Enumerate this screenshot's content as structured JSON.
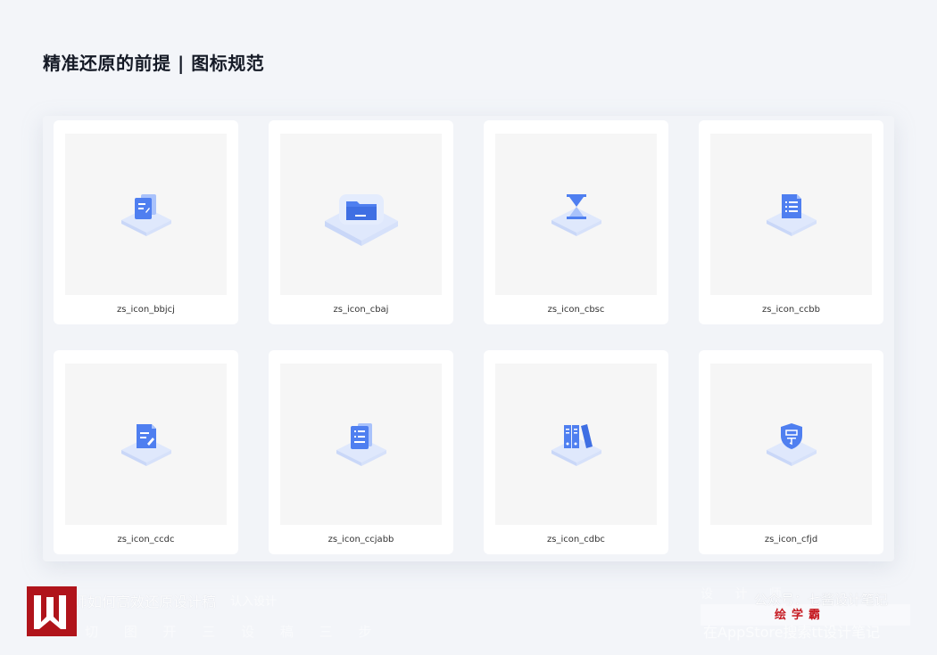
{
  "header": {
    "title": "精准还原的前提 | 图标规范"
  },
  "icons": [
    {
      "name": "zs_icon_bbjcj"
    },
    {
      "name": "zs_icon_cbaj"
    },
    {
      "name": "zs_icon_cbsc"
    },
    {
      "name": "zs_icon_ccbb"
    },
    {
      "name": "zs_icon_ccdc"
    },
    {
      "name": "zs_icon_ccjabb"
    },
    {
      "name": "zs_icon_cdbc"
    },
    {
      "name": "zs_icon_cfjd"
    }
  ],
  "icon_colors": {
    "primary": "#4f7ff0",
    "light": "#a9c2fb",
    "base": "#dfe8fc"
  },
  "footer": {
    "watermark_left": "师如何高效还原设计稿",
    "watermark_left_small": "认入设计",
    "watermark_row": "切 图 开 三 设 稿 三 步",
    "watermark_right_row": "设 计 师",
    "watermark_right_bottom": "在AppStore搜索tt设计笔记",
    "public_account": "公众号：七酱设计笔记",
    "brand": "绘学霸"
  }
}
